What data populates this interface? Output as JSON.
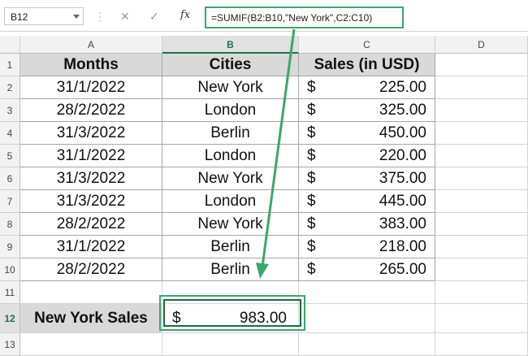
{
  "formula_bar": {
    "name_box": "B12",
    "cancel_icon": "✕",
    "enter_icon": "✓",
    "fx_label": "fx",
    "formula": "=SUMIF(B2:B10,\"New York\",C2:C10)"
  },
  "columns": [
    "A",
    "B",
    "C",
    "D"
  ],
  "rows": [
    "1",
    "2",
    "3",
    "4",
    "5",
    "6",
    "7",
    "8",
    "9",
    "10",
    "11",
    "12",
    "13"
  ],
  "table": {
    "headers": [
      "Months",
      "Cities",
      "Sales (in USD)"
    ],
    "rows": [
      {
        "month": "31/1/2022",
        "city": "New York",
        "currency": "$",
        "sales": "225.00"
      },
      {
        "month": "28/2/2022",
        "city": "London",
        "currency": "$",
        "sales": "325.00"
      },
      {
        "month": "31/3/2022",
        "city": "Berlin",
        "currency": "$",
        "sales": "450.00"
      },
      {
        "month": "31/1/2022",
        "city": "London",
        "currency": "$",
        "sales": "220.00"
      },
      {
        "month": "31/3/2022",
        "city": "New York",
        "currency": "$",
        "sales": "375.00"
      },
      {
        "month": "31/3/2022",
        "city": "London",
        "currency": "$",
        "sales": "445.00"
      },
      {
        "month": "28/2/2022",
        "city": "New York",
        "currency": "$",
        "sales": "383.00"
      },
      {
        "month": "31/1/2022",
        "city": "Berlin",
        "currency": "$",
        "sales": "218.00"
      },
      {
        "month": "28/2/2022",
        "city": "Berlin",
        "currency": "$",
        "sales": "265.00"
      }
    ]
  },
  "summary": {
    "label": "New York Sales",
    "currency": "$",
    "value": "983.00"
  },
  "accent_color": "#3aa76d",
  "selected_cell": "B12"
}
